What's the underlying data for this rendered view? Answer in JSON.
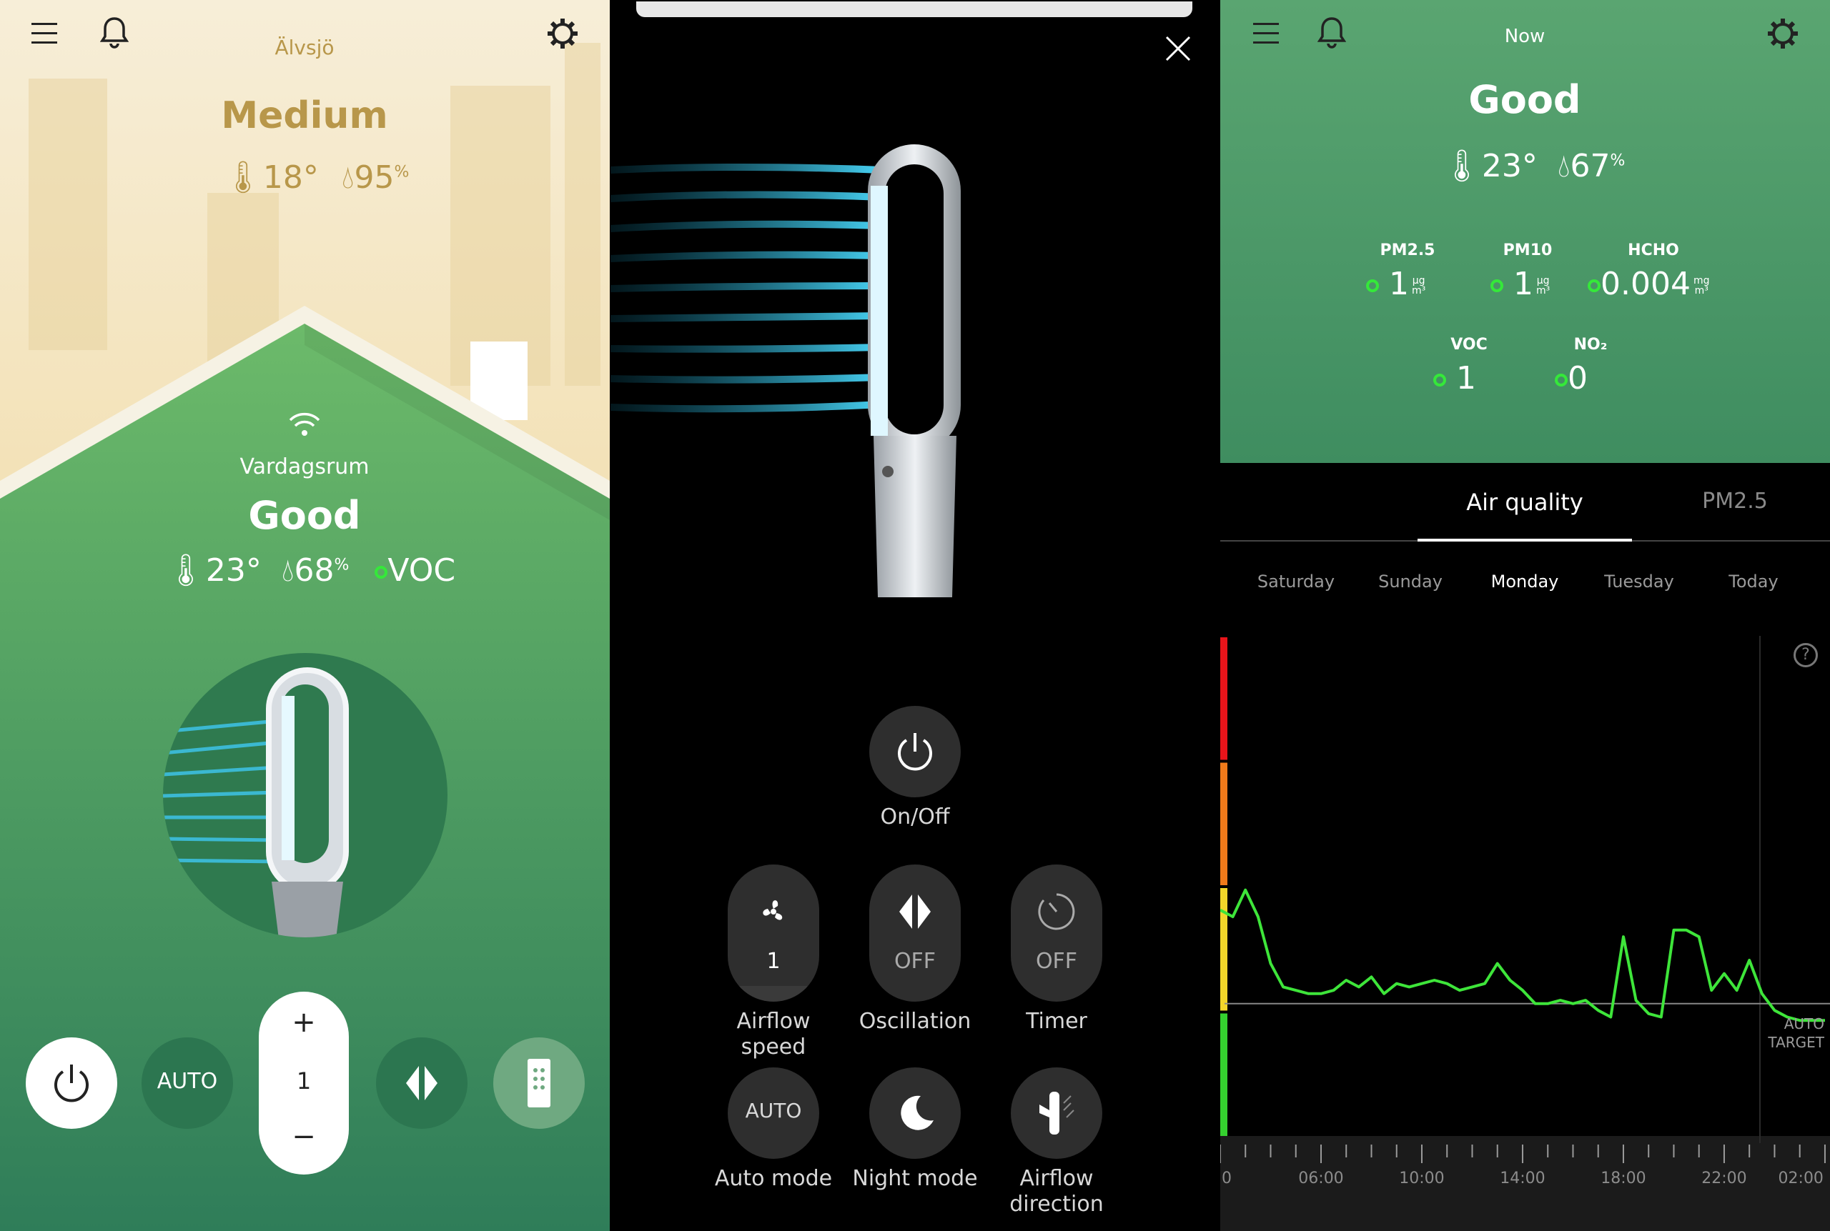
{
  "panel_left": {
    "location": "Älvsjö",
    "outdoor_quality": "Medium",
    "outdoor_temp": "18°",
    "outdoor_humidity": "95",
    "humidity_unit": "%",
    "room_name": "Vardagsrum",
    "indoor_quality": "Good",
    "indoor_temp": "23°",
    "indoor_humidity": "68",
    "pollutant": "VOC",
    "controls": {
      "auto_label": "AUTO",
      "speed_plus": "+",
      "speed_value": "1",
      "speed_minus": "−"
    },
    "colors": {
      "accent_gold": "#b8974a",
      "green_top": "#6cba6a",
      "green_bottom": "#2f7d59"
    },
    "icons": [
      "menu-icon",
      "bell-icon",
      "gear-icon",
      "wifi-icon",
      "thermometer-icon",
      "droplet-icon",
      "power-icon",
      "oscillation-icon",
      "remote-icon"
    ]
  },
  "panel_middle": {
    "power_label": "On/Off",
    "airflow_speed_value": "1",
    "airflow_speed_label_1": "Airflow",
    "airflow_speed_label_2": "speed",
    "oscillation_value": "OFF",
    "oscillation_label": "Oscillation",
    "timer_value": "OFF",
    "timer_label": "Timer",
    "auto_value": "AUTO",
    "auto_label": "Auto mode",
    "night_label": "Night mode",
    "airflow_dir_label_1": "Airflow",
    "airflow_dir_label_2": "direction",
    "icons": [
      "close-icon",
      "power-icon",
      "fan-icon",
      "oscillation-icon",
      "timer-icon",
      "moon-icon",
      "airflow-direction-icon"
    ]
  },
  "panel_right": {
    "header": "Now",
    "quality": "Good",
    "temp": "23°",
    "humidity": "67",
    "humidity_unit": "%",
    "metrics": [
      {
        "label": "PM2.5",
        "value": "1",
        "unit_top": "µg",
        "unit_bottom": "m³"
      },
      {
        "label": "PM10",
        "value": "1",
        "unit_top": "µg",
        "unit_bottom": "m³"
      },
      {
        "label": "HCHO",
        "value": "0.004",
        "unit_top": "mg",
        "unit_bottom": "m³"
      },
      {
        "label": "VOC",
        "value": "1"
      },
      {
        "label": "NO₂",
        "value": "0"
      }
    ],
    "tabs": [
      {
        "label": "Air quality",
        "active": true
      },
      {
        "label": "PM2.5",
        "active": false
      }
    ],
    "days": [
      "Saturday",
      "Sunday",
      "Monday",
      "Tuesday",
      "Today"
    ],
    "selected_day": "Monday",
    "target_label_1": "AUTO",
    "target_label_2": "TARGET",
    "help": "?",
    "colors": {
      "header_green": "#4f9a68",
      "line_green": "#3ee53a"
    },
    "icons": [
      "menu-icon",
      "bell-icon",
      "gear-icon",
      "help-icon",
      "thermometer-icon",
      "droplet-icon"
    ]
  },
  "chart_data": {
    "type": "line",
    "x_tick_labels": [
      "0",
      "06:00",
      "10:00",
      "14:00",
      "18:00",
      "22:00",
      "02:00"
    ],
    "x_hours": [
      2,
      2.5,
      3,
      3.5,
      4,
      4.5,
      5,
      5.5,
      6,
      6.5,
      7,
      7.5,
      8,
      8.5,
      9,
      9.5,
      10,
      10.5,
      11,
      11.5,
      12,
      12.5,
      13,
      13.5,
      14,
      14.5,
      15,
      15.5,
      16,
      16.5,
      17,
      17.5,
      18,
      18.5,
      19,
      19.5,
      20,
      20.5,
      21,
      21.5,
      22,
      22.5,
      23,
      23.5,
      24,
      24.5,
      25,
      25.5,
      26
    ],
    "series": [
      {
        "values": [
          68,
          66,
          74,
          66,
          52,
          45,
          44,
          43,
          43,
          44,
          47,
          45,
          48,
          43,
          46,
          45,
          46,
          47,
          46,
          44,
          45,
          46,
          52,
          47,
          44,
          40,
          40,
          41,
          40,
          41,
          38,
          36,
          60,
          41,
          37,
          36,
          62,
          62,
          60,
          44,
          49,
          44,
          53,
          43,
          38,
          36,
          35,
          35,
          35
        ]
      }
    ],
    "target_value": 40,
    "ylim": [
      0,
      150
    ],
    "scale_bands": [
      "#35d12f",
      "#f2d62a",
      "#f07a1a",
      "#e8141a"
    ]
  }
}
